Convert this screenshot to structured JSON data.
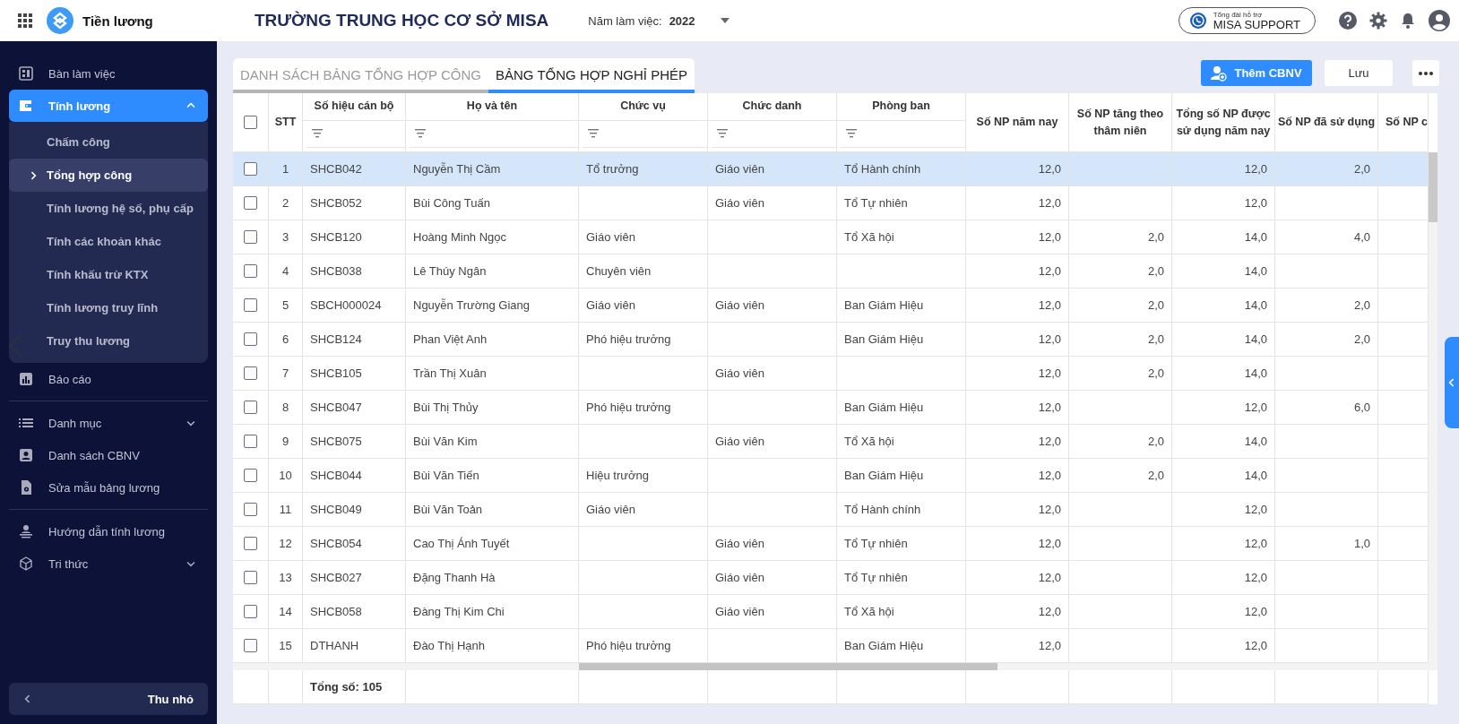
{
  "app": {
    "name": "Tiền lương"
  },
  "header": {
    "school": "TRƯỜNG TRUNG HỌC CƠ SỞ MISA",
    "year_label": "Năm làm việc:",
    "year": "2022",
    "support_caption": "Tổng đài hỗ trợ",
    "support_name": "MISA SUPPORT"
  },
  "sidebar": {
    "sections": [
      {
        "items": [
          {
            "label": "Bàn làm việc",
            "selected": false
          },
          {
            "label": "Tính lương",
            "selected": true,
            "expanded": true,
            "children": [
              {
                "label": "Chấm công",
                "selected": false
              },
              {
                "label": "Tổng hợp công",
                "selected": true
              },
              {
                "label": "Tính lương hệ số, phụ cấp",
                "selected": false
              },
              {
                "label": "Tính các khoản khác",
                "selected": false
              },
              {
                "label": "Tính khấu trừ KTX",
                "selected": false
              },
              {
                "label": "Tính lương truy lĩnh",
                "selected": false
              },
              {
                "label": "Truy thu lương",
                "selected": false
              }
            ]
          },
          {
            "label": "Báo cáo",
            "selected": false
          }
        ]
      },
      {
        "items": [
          {
            "label": "Danh mục",
            "selected": false,
            "expanded": false
          },
          {
            "label": "Danh sách CBNV",
            "selected": false
          },
          {
            "label": "Sửa mẫu bảng lương",
            "selected": false
          }
        ]
      },
      {
        "items": [
          {
            "label": "Hướng dẫn tính lương",
            "selected": false
          },
          {
            "label": "Tri thức",
            "selected": false,
            "expanded": false
          }
        ]
      }
    ],
    "collapse_label": "Thu nhỏ"
  },
  "tabs": [
    {
      "label": "DANH SÁCH BẢNG TỔNG HỢP CÔNG",
      "selected": false
    },
    {
      "label": "BẢNG TỔNG HỢP NGHỈ PHÉP",
      "selected": true
    }
  ],
  "actions": {
    "add": "Thêm CBNV",
    "save": "Lưu"
  },
  "table": {
    "all_checked": false,
    "columns": [
      {
        "label": "STT"
      },
      {
        "label": "Số hiệu cán bộ",
        "filter": true
      },
      {
        "label": "Họ và tên",
        "filter": true
      },
      {
        "label": "Chức vụ",
        "filter": true
      },
      {
        "label": "Chức danh",
        "filter": true
      },
      {
        "label": "Phòng ban",
        "filter": true
      },
      {
        "label": "Số NP năm nay"
      },
      {
        "label": "Số NP tăng theo thâm niên"
      },
      {
        "label": "Tổng số NP được sử dụng năm nay"
      },
      {
        "label": "Số NP đã sử dụng"
      },
      {
        "label": "Số NP c"
      }
    ],
    "rows": [
      {
        "selected": true,
        "checked": false,
        "cells": [
          "1",
          "SHCB042",
          "Nguyễn Thị Cầm",
          "Tổ trưởng",
          "Giáo viên",
          "Tổ Hành chính",
          "12,0",
          null,
          "12,0",
          "2,0",
          null
        ]
      },
      {
        "selected": false,
        "checked": false,
        "cells": [
          "2",
          "SHCB052",
          "Bùi Công Tuấn",
          null,
          "Giáo viên",
          "Tổ Tự nhiên",
          "12,0",
          null,
          "12,0",
          null,
          null
        ]
      },
      {
        "selected": false,
        "checked": false,
        "cells": [
          "3",
          "SHCB120",
          "Hoàng Minh Ngọc",
          "Giáo viên",
          null,
          "Tổ Xã hội",
          "12,0",
          "2,0",
          "14,0",
          "4,0",
          null
        ]
      },
      {
        "selected": false,
        "checked": false,
        "cells": [
          "4",
          "SHCB038",
          "Lê Thúy Ngân",
          "Chuyên viên",
          null,
          null,
          "12,0",
          "2,0",
          "14,0",
          null,
          null
        ]
      },
      {
        "selected": false,
        "checked": false,
        "cells": [
          "5",
          "SBCH000024",
          "Nguyễn Trường Giang",
          "Giáo viên",
          "Giáo viên",
          "Ban Giám Hiệu",
          "12,0",
          "2,0",
          "14,0",
          "2,0",
          null
        ]
      },
      {
        "selected": false,
        "checked": false,
        "cells": [
          "6",
          "SHCB124",
          "Phan Việt Anh",
          "Phó hiệu trưởng",
          null,
          "Ban Giám Hiệu",
          "12,0",
          "2,0",
          "14,0",
          "2,0",
          null
        ]
      },
      {
        "selected": false,
        "checked": false,
        "cells": [
          "7",
          "SHCB105",
          "Trần Thị Xuân",
          null,
          "Giáo viên",
          null,
          "12,0",
          "2,0",
          "14,0",
          null,
          null
        ]
      },
      {
        "selected": false,
        "checked": false,
        "cells": [
          "8",
          "SHCB047",
          "Bùi Thị Thủy",
          "Phó hiệu trưởng",
          null,
          "Ban Giám Hiệu",
          "12,0",
          null,
          "12,0",
          "6,0",
          null
        ]
      },
      {
        "selected": false,
        "checked": false,
        "cells": [
          "9",
          "SHCB075",
          "Bùi Văn Kim",
          null,
          "Giáo viên",
          "Tổ Xã hội",
          "12,0",
          "2,0",
          "14,0",
          null,
          null
        ]
      },
      {
        "selected": false,
        "checked": false,
        "cells": [
          "10",
          "SHCB044",
          "Bùi Văn Tiến",
          "Hiệu trưởng",
          null,
          "Ban Giám Hiệu",
          "12,0",
          "2,0",
          "14,0",
          null,
          null
        ]
      },
      {
        "selected": false,
        "checked": false,
        "cells": [
          "11",
          "SHCB049",
          "Bùi Văn Toản",
          "Giáo viên",
          null,
          "Tổ Hành chính",
          "12,0",
          null,
          "12,0",
          null,
          null
        ]
      },
      {
        "selected": false,
        "checked": false,
        "cells": [
          "12",
          "SHCB054",
          "Cao Thị Ánh Tuyết",
          null,
          "Giáo viên",
          "Tổ Tự nhiên",
          "12,0",
          null,
          "12,0",
          "1,0",
          null
        ]
      },
      {
        "selected": false,
        "checked": false,
        "cells": [
          "13",
          "SHCB027",
          "Đặng Thanh Hà",
          null,
          "Giáo viên",
          "Tổ Tự nhiên",
          "12,0",
          null,
          "12,0",
          null,
          null
        ]
      },
      {
        "selected": false,
        "checked": false,
        "cells": [
          "14",
          "SHCB058",
          "Đàng Thị Kim Chi",
          null,
          "Giáo viên",
          "Tổ Xã hội",
          "12,0",
          null,
          "12,0",
          null,
          null
        ]
      },
      {
        "selected": false,
        "checked": false,
        "cells": [
          "15",
          "DTHANH",
          "Đào Thị Hạnh",
          "Phó hiệu trưởng",
          null,
          "Ban Giám Hiệu",
          "12,0",
          null,
          "12,0",
          null,
          null
        ]
      }
    ],
    "footer": "Tổng số: 105"
  }
}
